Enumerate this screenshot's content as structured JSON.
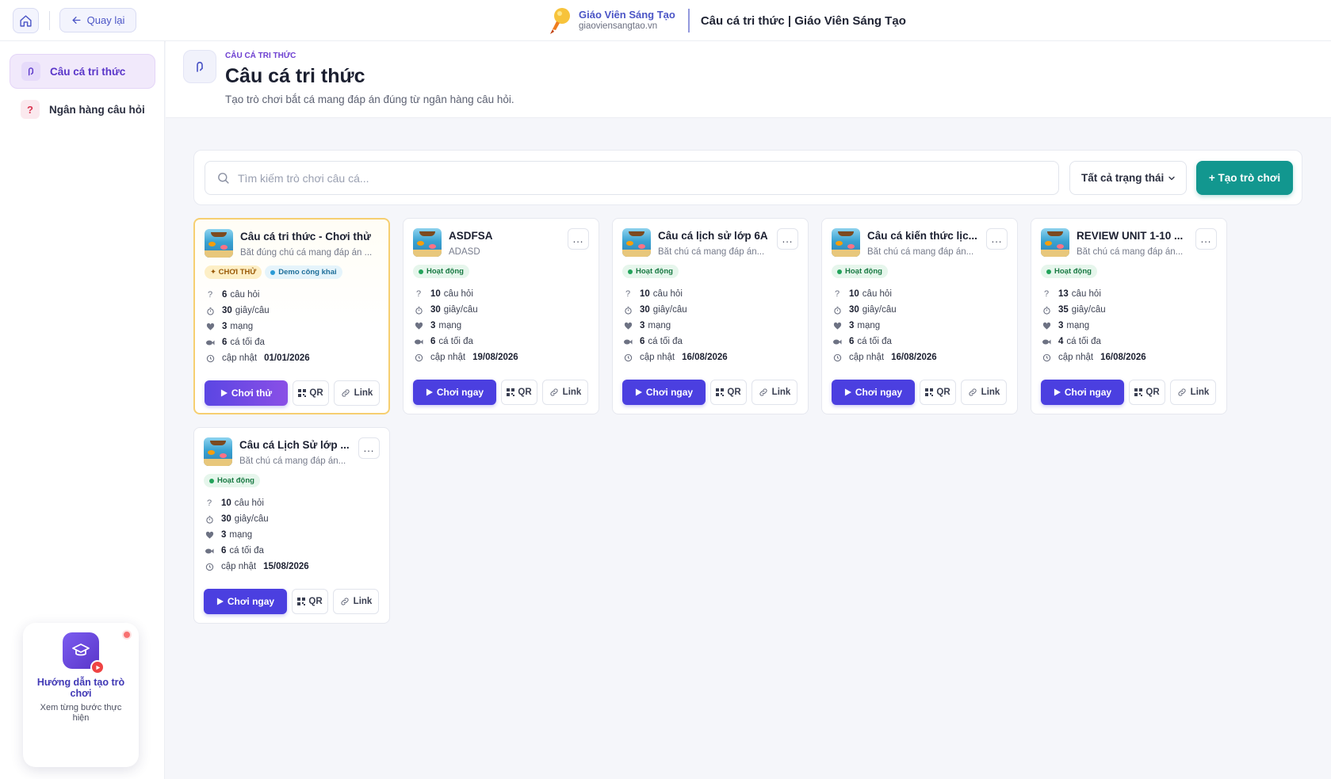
{
  "topbar": {
    "back_label": "Quay lại",
    "brand_name": "Giáo Viên Sáng Tạo",
    "brand_domain": "giaoviensangtao.vn",
    "page_heading": "Câu cá tri thức | Giáo Viên Sáng Tạo"
  },
  "sidebar": {
    "items": [
      {
        "label": "Câu cá tri thức",
        "active": true
      },
      {
        "label": "Ngân hàng câu hỏi",
        "active": false
      }
    ],
    "guide": {
      "title": "Hướng dẫn tạo trò chơi",
      "subtitle": "Xem từng bước thực hiện"
    }
  },
  "header": {
    "eyebrow": "CÂU CÁ TRI THỨC",
    "title": "Câu cá tri thức",
    "description": "Tạo trò chơi bắt cá mang đáp án đúng từ ngân hàng câu hỏi."
  },
  "toolbar": {
    "search_placeholder": "Tìm kiếm trò chơi câu cá...",
    "status_filter": "Tất cả trạng thái",
    "create_label": "+ Tạo trò chơi"
  },
  "labels": {
    "questions": "câu hỏi",
    "seconds": "giây/câu",
    "lives": "mạng",
    "max_fish": "cá tối đa",
    "updated": "cập nhật",
    "qr": "QR",
    "link": "Link",
    "more": "..."
  },
  "cards": [
    {
      "title": "Câu cá tri thức - Chơi thử",
      "subtitle": "Bắt đúng chú cá mang đáp án ...",
      "badges": [
        {
          "text": "✦ CHƠI THỬ",
          "kind": "trial"
        },
        {
          "text": "Demo công khai",
          "kind": "demo"
        }
      ],
      "questions": "6",
      "seconds": "30",
      "lives": "3",
      "max_fish": "6",
      "updated": "01/01/2026",
      "play_label": "Chơi thử",
      "trial": true
    },
    {
      "title": "ASDFSA",
      "subtitle": "ADASD",
      "badges": [
        {
          "text": "Hoạt động",
          "kind": "active"
        }
      ],
      "questions": "10",
      "seconds": "30",
      "lives": "3",
      "max_fish": "6",
      "updated": "19/08/2026",
      "play_label": "Chơi ngay",
      "trial": false
    },
    {
      "title": "Câu cá lịch sử lớp 6A",
      "subtitle": "Bắt chú cá mang đáp án...",
      "badges": [
        {
          "text": "Hoạt động",
          "kind": "active"
        }
      ],
      "questions": "10",
      "seconds": "30",
      "lives": "3",
      "max_fish": "6",
      "updated": "16/08/2026",
      "play_label": "Chơi ngay",
      "trial": false
    },
    {
      "title": "Câu cá kiến thức lịc...",
      "subtitle": "Bắt chú cá mang đáp án...",
      "badges": [
        {
          "text": "Hoạt động",
          "kind": "active"
        }
      ],
      "questions": "10",
      "seconds": "30",
      "lives": "3",
      "max_fish": "6",
      "updated": "16/08/2026",
      "play_label": "Chơi ngay",
      "trial": false
    },
    {
      "title": "REVIEW UNIT 1-10 ...",
      "subtitle": "Bắt chú cá mang đáp án...",
      "badges": [
        {
          "text": "Hoạt động",
          "kind": "active"
        }
      ],
      "questions": "13",
      "seconds": "35",
      "lives": "3",
      "max_fish": "4",
      "updated": "16/08/2026",
      "play_label": "Chơi ngay",
      "trial": false
    },
    {
      "title": "Câu cá Lịch Sử lớp ...",
      "subtitle": "Bắt chú cá mang đáp án...",
      "badges": [
        {
          "text": "Hoạt động",
          "kind": "active"
        }
      ],
      "questions": "10",
      "seconds": "30",
      "lives": "3",
      "max_fish": "6",
      "updated": "15/08/2026",
      "play_label": "Chơi ngay",
      "trial": false
    }
  ]
}
